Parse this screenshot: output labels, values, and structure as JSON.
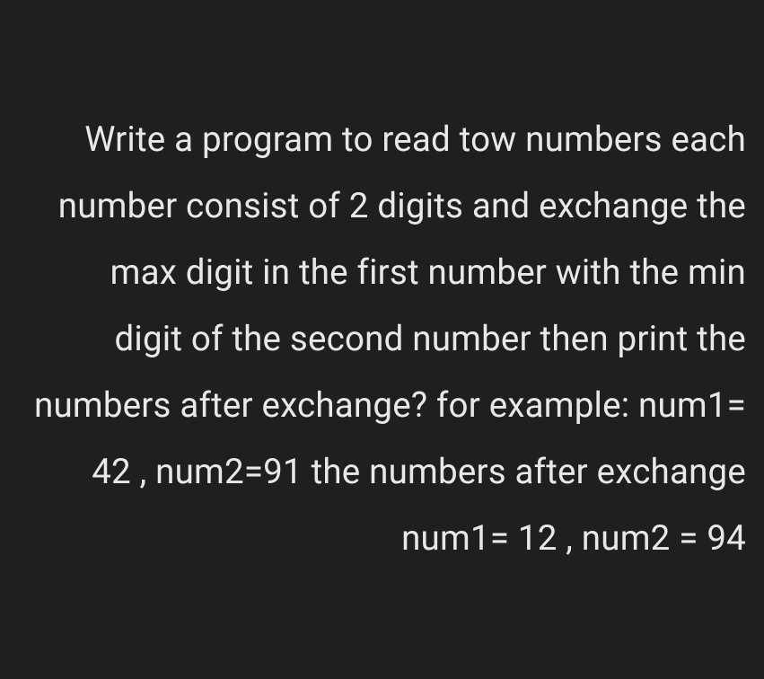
{
  "content": {
    "paragraph": "Write a program to read tow numbers each number consist of 2 digits and exchange the max digit in the first number with the min digit of the second number then print the numbers after exchange? for example: num1= 42 , num2=91 the numbers after exchange num1= 12 , num2 = 94"
  }
}
